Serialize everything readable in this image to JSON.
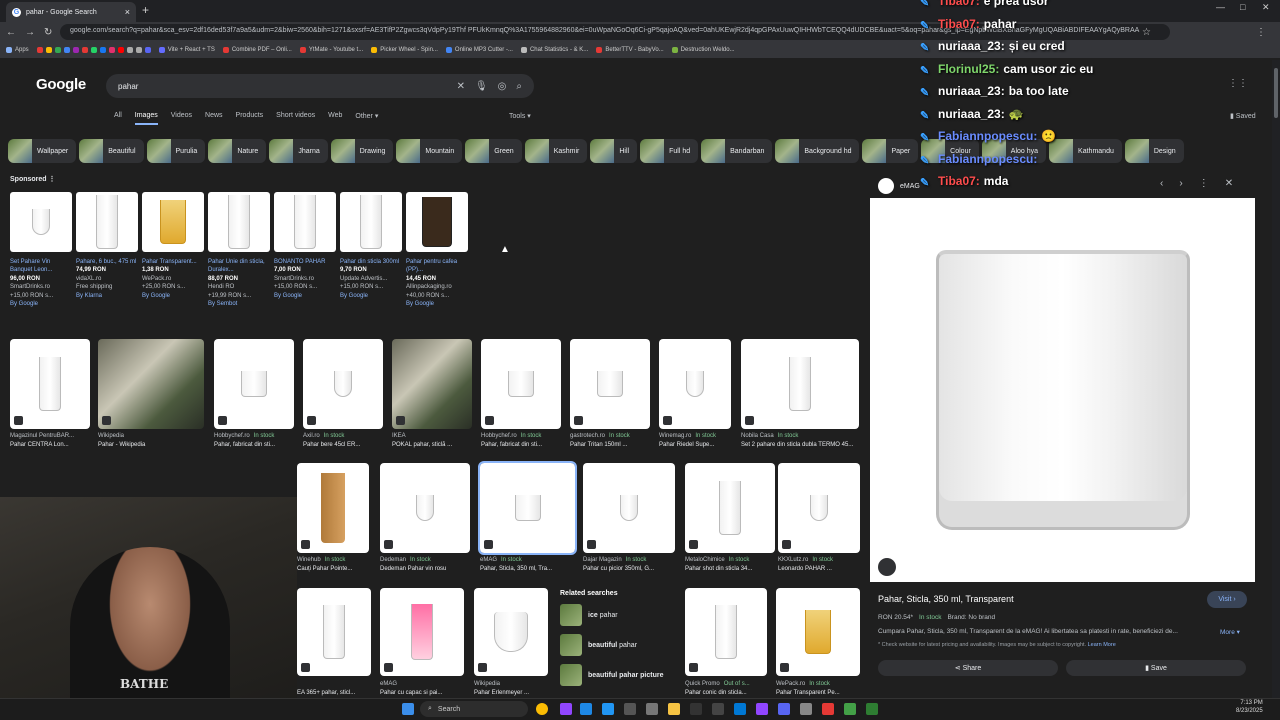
{
  "browser": {
    "tab_title": "pahar - Google Search",
    "url": "google.com/search?q=pahar&sca_esv=2df16ded53f7a9a5&udm=2&biw=2560&bih=1271&sxsrf=AE3TifP2Zgwcs3qVdpPy19Thf PFUkKmnqQ%3A1755964882960&ei=0uWpaNGoOq6Ci-gP5qajoAQ&ved=0ahUKEwjR2dj4qpGPAxUuwQIHHWbTCEQQ4dUDCBE&uact=5&oq=pahar&gs_lp=EgNpbWciBXBhaGFyMgUQABiABDIFEAAYgAQyBRAA",
    "apps": "Apps"
  },
  "bookmarks": [
    "Vite + React + TS",
    "Combine PDF – Onli...",
    "YtMate - Youtube t...",
    "Picker Wheel - Spin...",
    "Online MP3 Cutter -...",
    "Chat Statistics - & K...",
    "BetterTTV - BabyVo...",
    "Destruction Weldo..."
  ],
  "search": {
    "logo": "Google",
    "query": "pahar"
  },
  "nav": {
    "tabs": [
      "All",
      "Images",
      "Videos",
      "News",
      "Products",
      "Short videos",
      "Web",
      "Other ▾"
    ],
    "tools": "Tools ▾",
    "saved": "Saved"
  },
  "chips": [
    "Wallpaper",
    "Beautiful",
    "Purulia",
    "Nature",
    "Jharna",
    "Drawing",
    "Mountain",
    "Green",
    "Kashmir",
    "Hill",
    "Full hd",
    "Bandarban",
    "Background hd",
    "Paper",
    "Colour",
    "Aloo hya",
    "Kathmandu",
    "Design"
  ],
  "sponsored": {
    "label": "Sponsored ⋮",
    "items": [
      {
        "t": "Set Pahare Vin Banquet Leon...",
        "p": "96,00 RON",
        "s": "SmartDrinks.ro",
        "f": "+15,00 RON s...",
        "by": "By Google",
        "kind": "wine"
      },
      {
        "t": "Pahare, 6 buc., 475 ml",
        "p": "74,99 RON",
        "s": "vidaXL.ro",
        "f": "Free shipping",
        "by": "By Klarna",
        "kind": "tall"
      },
      {
        "t": "Pahar Transparent...",
        "p": "1,38 RON",
        "s": "WePack.ro",
        "f": "+25,00 RON s...",
        "by": "By Google",
        "kind": "beer"
      },
      {
        "t": "Pahar Unie din sticla, Duralex...",
        "p": "88,07 RON",
        "s": "Hendi RO",
        "f": "+19,99 RON s...",
        "by": "By Sembot",
        "kind": "tall"
      },
      {
        "t": "BONANTO PAHAR",
        "p": "7,00 RON",
        "s": "SmartDrinks.ro",
        "f": "+15,00 RON s...",
        "by": "By Google",
        "kind": "tall"
      },
      {
        "t": "Pahar din sticla 300ml",
        "p": "9,70 RON",
        "s": "Update Advertis...",
        "f": "+15,00 RON s...",
        "by": "By Google",
        "kind": "tall"
      },
      {
        "t": "Pahar pentru cafea (PP)...",
        "p": "14,45 RON",
        "s": "Allinpackaging.ro",
        "f": "+40,00 RON s...",
        "by": "By Google",
        "kind": "dark"
      }
    ]
  },
  "results_row1": [
    {
      "src": "Magazinul PentruBAR...",
      "stock": "",
      "ttl": "Pahar CENTRA Lon...",
      "kind": "tall"
    },
    {
      "src": "Wikipedia",
      "stock": "",
      "ttl": "Pahar - Wikipedia",
      "kind": "photo"
    },
    {
      "src": "Hobbychef.ro",
      "stock": "In stock",
      "ttl": "Pahar, fabricat din sti...",
      "kind": "short"
    },
    {
      "src": "Axil.ro",
      "stock": "In stock",
      "ttl": "Pahar bere 45cl ER...",
      "kind": "wine"
    },
    {
      "src": "IKEA",
      "stock": "",
      "ttl": "POKAL pahar, sticlă ...",
      "kind": "photo"
    },
    {
      "src": "Hobbychef.ro",
      "stock": "In stock",
      "ttl": "Pahar, fabricat din sti...",
      "kind": "short"
    },
    {
      "src": "gastrotech.ro",
      "stock": "In stock",
      "ttl": "Pahar Tritan 150ml ...",
      "kind": "short"
    },
    {
      "src": "Winemag.ro",
      "stock": "In stock",
      "ttl": "Pahar Riedel Supe...",
      "kind": "wine"
    },
    {
      "src": "Nobila Casa",
      "stock": "In stock",
      "ttl": "Set 2 pahare din sticla dubla TERMO 45...",
      "kind": "tall"
    }
  ],
  "results_row2": [
    {
      "src": "Winehub",
      "stock": "In stock",
      "ttl": "Cauți Pahar Pointe...",
      "kind": "wood"
    },
    {
      "src": "Dedeman",
      "stock": "In stock",
      "ttl": "Dedeman Pahar vin rosu",
      "kind": "wine"
    },
    {
      "src": "eMAG",
      "stock": "In stock",
      "ttl": "Pahar, Sticla, 350 ml, Tra...",
      "kind": "short"
    },
    {
      "src": "Dajar Magazin",
      "stock": "In stock",
      "ttl": "Pahar cu picior 350ml, G...",
      "kind": "wine"
    },
    {
      "src": "MetaloChimice",
      "stock": "In stock",
      "ttl": "Pahar shot din sticla 34...",
      "kind": "tall"
    },
    {
      "src": "KKXLutz.ro",
      "stock": "In stock",
      "ttl": "Leonardo PAHAR ...",
      "kind": "wine"
    }
  ],
  "results_row3": [
    {
      "src": "",
      "stock": "",
      "ttl": "EA 365+ pahar, sticl...",
      "kind": "tall"
    },
    {
      "src": "eMAG",
      "stock": "",
      "ttl": "Pahar cu capac si pai...",
      "kind": "tumbler"
    },
    {
      "src": "Wikipedia",
      "stock": "",
      "ttl": "Pahar Erlenmeyer ...",
      "kind": "flask"
    },
    {
      "src": "Quick Promo",
      "stock": "Out of s...",
      "ttl": "Pahar conic din sticla...",
      "kind": "tall"
    },
    {
      "src": "WePack.ro",
      "stock": "In stock",
      "ttl": "Pahar Transparent Pe...",
      "kind": "beer"
    }
  ],
  "related": {
    "heading": "Related searches",
    "items": [
      {
        "a": "ice ",
        "b": "pahar"
      },
      {
        "a": "beautiful ",
        "b": "pahar"
      },
      {
        "a": "beautiful ",
        "b": "pahar picture"
      }
    ]
  },
  "panel": {
    "source": "eMAG",
    "title": "Pahar, Sticla, 350 ml, Transparent",
    "visit": "Visit ›",
    "price": "RON 20.54*",
    "stock": "In stock",
    "brand": "Brand: No brand",
    "desc": "Cumpara Pahar, Sticla, 350 ml, Transparent de la eMAG! Ai libertatea sa platesti in rate, beneficiezi de...",
    "more": "More ▾",
    "note": "* Check website for latest pricing and availability. Images may be subject to copyright.",
    "learn": "Learn More",
    "share": "Share",
    "save": "Save"
  },
  "chat": [
    {
      "user": "Tiba07:",
      "msg": "e prea usor",
      "color": "#ff4d4d"
    },
    {
      "user": "Tiba07:",
      "msg": "pahar",
      "color": "#ff4d4d"
    },
    {
      "user": "nuriaaa_23:",
      "msg": "și eu cred",
      "color": "#ffffff"
    },
    {
      "user": "Florinul25:",
      "msg": "cam usor zic eu",
      "color": "#7fd66b"
    },
    {
      "user": "nuriaaa_23:",
      "msg": "ba too late",
      "color": "#ffffff"
    },
    {
      "user": "nuriaaa_23:",
      "msg": "🐢",
      "color": "#ffffff"
    },
    {
      "user": "Fabiannpopescu:",
      "msg": "🙁",
      "color": "#6a8cff"
    },
    {
      "user": "Fabiannpopescu:",
      "msg": "",
      "color": "#6a8cff"
    },
    {
      "user": "Tiba07:",
      "msg": "mda",
      "color": "#ff4d4d"
    }
  ],
  "webcam": {
    "shirt_text": "BATHE"
  },
  "taskbar": {
    "search": "Search",
    "time": "7:13 PM",
    "date": "8/23/2025"
  }
}
